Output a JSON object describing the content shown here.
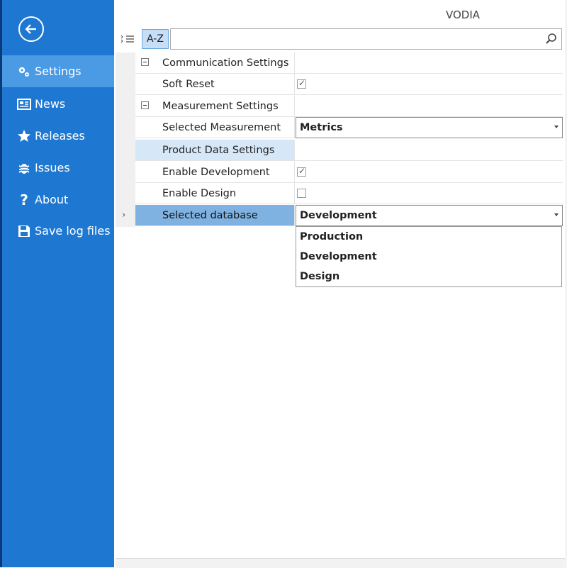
{
  "app": {
    "title": "VODIA"
  },
  "sidebar": {
    "items": [
      {
        "label": "Settings",
        "icon": "gears-icon",
        "active": true
      },
      {
        "label": "News",
        "icon": "newspaper-icon"
      },
      {
        "label": "Releases",
        "icon": "star-icon"
      },
      {
        "label": "Issues",
        "icon": "bug-icon"
      },
      {
        "label": "About",
        "icon": "question-icon"
      },
      {
        "label": "Save log files",
        "icon": "floppy-disk-icon"
      }
    ]
  },
  "toolbar": {
    "az_label": "A-Z",
    "search_value": ""
  },
  "properties": {
    "communication": {
      "label": "Communication Settings"
    },
    "soft_reset": {
      "label": "Soft Reset",
      "checked": true,
      "check_glyph": "✓"
    },
    "measurement": {
      "label": "Measurement Settings"
    },
    "selected_measurement": {
      "label": "Selected Measurement",
      "value": "Metrics"
    },
    "product_data": {
      "label": "Product Data Settings"
    },
    "enable_development": {
      "label": "Enable Development",
      "checked": true,
      "check_glyph": "✓"
    },
    "enable_design": {
      "label": "Enable Design",
      "checked": false
    },
    "selected_database": {
      "label": "Selected database",
      "value": "Development"
    }
  },
  "database_options": [
    "Production",
    "Development",
    "Design"
  ],
  "colors": {
    "sidebar": "#1e78d2",
    "active_item": "#4a9ae4",
    "selected_row": "#7fb2e0"
  }
}
